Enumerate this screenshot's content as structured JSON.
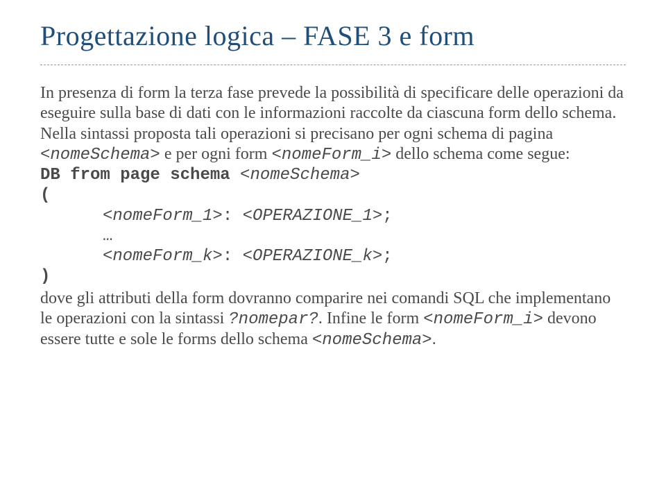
{
  "title": "Progettazione logica – FASE 3 e form",
  "para1_a": "In presenza di form la terza fase prevede la possibilità di specificare delle operazioni da eseguire sulla base di dati con le informazioni raccolte da ciascuna form dello schema. Nella sintassi proposta tali operazioni si precisano per ogni schema di pagina ",
  "code1": "<nomeSchema>",
  "para1_b": " e per ogni form ",
  "code2": "<nomeForm_i>",
  "para1_c": " dello schema come segue:",
  "db_line_a": "DB from page schema ",
  "db_line_b": "<nomeSchema>",
  "open_paren": "(",
  "line1_a": "<nomeForm_1>",
  "line1_b": ": ",
  "line1_c": "<OPERAZIONE_1>",
  "line1_d": ";",
  "ellipsis": "…",
  "line2_a": "<nomeForm_k>",
  "line2_b": ": ",
  "line2_c": "<OPERAZIONE_k>",
  "line2_d": ";",
  "close_paren": ")",
  "para2_a": "dove gli attributi della form dovranno comparire nei comandi SQL che implementano le operazioni con la sintassi ",
  "code3": "?nomepar?",
  "para2_b": ". Infine le form ",
  "code4": "<nomeForm_i>",
  "para2_c": " devono essere tutte e sole le forms dello schema ",
  "code5": "<nomeSchema>",
  "para2_d": "."
}
